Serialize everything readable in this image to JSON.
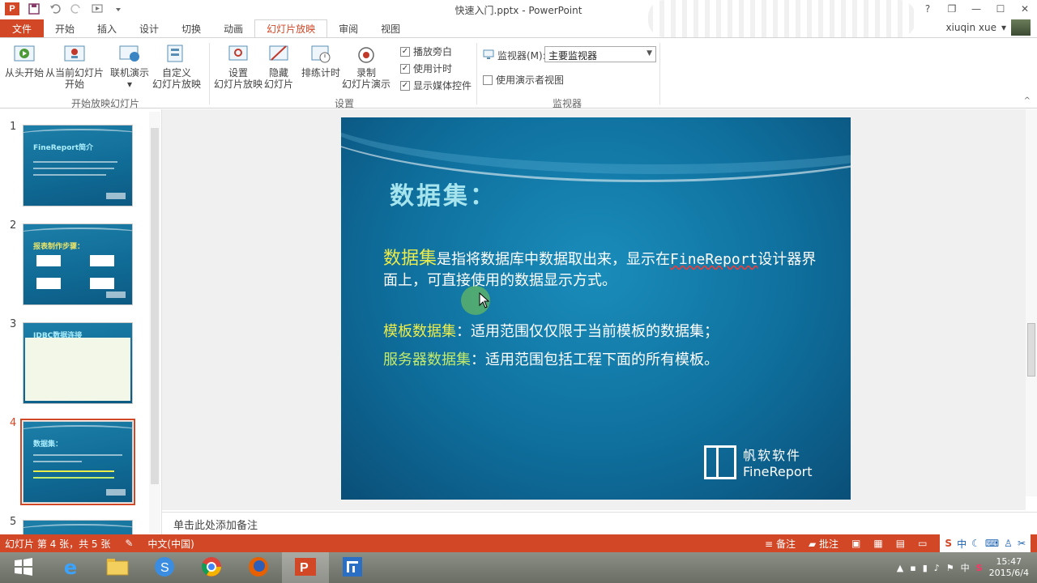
{
  "window": {
    "title": "快速入门.pptx - PowerPoint"
  },
  "qat": {
    "app_icon": "P"
  },
  "window_controls": {
    "help": "?",
    "restore": "❐",
    "minimize": "—",
    "maximize": "☐",
    "close": "✕"
  },
  "user": {
    "name": "xiuqin xue"
  },
  "tabs": [
    {
      "label": "文件"
    },
    {
      "label": "开始"
    },
    {
      "label": "插入"
    },
    {
      "label": "设计"
    },
    {
      "label": "切换"
    },
    {
      "label": "动画"
    },
    {
      "label": "幻灯片放映"
    },
    {
      "label": "审阅"
    },
    {
      "label": "视图"
    }
  ],
  "ribbon": {
    "from_beginning": "从头开始",
    "from_current_1": "从当前幻灯片",
    "from_current_2": "开始",
    "online_present": "联机演示",
    "custom_1": "自定义",
    "custom_2": "幻灯片放映",
    "group_start": "开始放映幻灯片",
    "setup_1": "设置",
    "setup_2": "幻灯片放映",
    "hide_1": "隐藏",
    "hide_2": "幻灯片",
    "rehearse": "排练计时",
    "record_1": "录制",
    "record_2": "幻灯片演示",
    "play_narration": "播放旁白",
    "use_timings": "使用计时",
    "show_media": "显示媒体控件",
    "group_setup": "设置",
    "monitor_label": "监视器(M):",
    "monitor_value": "主要监视器",
    "presenter_view": "使用演示者视图",
    "group_monitors": "监视器"
  },
  "thumbnails": [
    {
      "num": "1",
      "title": "FineReport简介"
    },
    {
      "num": "2",
      "title": "报表制作步骤："
    },
    {
      "num": "3",
      "title": "JDBC数据连接"
    },
    {
      "num": "4",
      "title": "数据集："
    },
    {
      "num": "5",
      "title": ""
    }
  ],
  "slide": {
    "title": "数据集：",
    "p1_term": "数据集",
    "p1_text_a": "是指将数据库中数据取出来，显示在",
    "p1_brand": "FineReport",
    "p1_text_b": "设计器界面上，可直接使用的数据显示方式。",
    "p2_term": "模板数据集",
    "p2_text": "：适用范围仅仅限于当前模板的数据集；",
    "p3_term": "服务器数据集",
    "p3_text": "：适用范围包括工程下面的所有模板。",
    "brand_cn": "帆软软件",
    "brand_en": "FineReport"
  },
  "notes": {
    "placeholder": "单击此处添加备注"
  },
  "status": {
    "slide_info": "幻灯片 第 4 张，共 5 张",
    "language": "中文(中国)",
    "notes_btn": "备注",
    "comments_btn": "批注",
    "ime_mode": "中"
  },
  "taskbar": {
    "time": "15:47",
    "date": "2015/6/4",
    "input_lang": "中"
  },
  "colors": {
    "accent": "#d24726",
    "slide_bg": "#0f6f9d",
    "title": "#a6e4ee",
    "highlight_yellow": "#ecec4a"
  }
}
